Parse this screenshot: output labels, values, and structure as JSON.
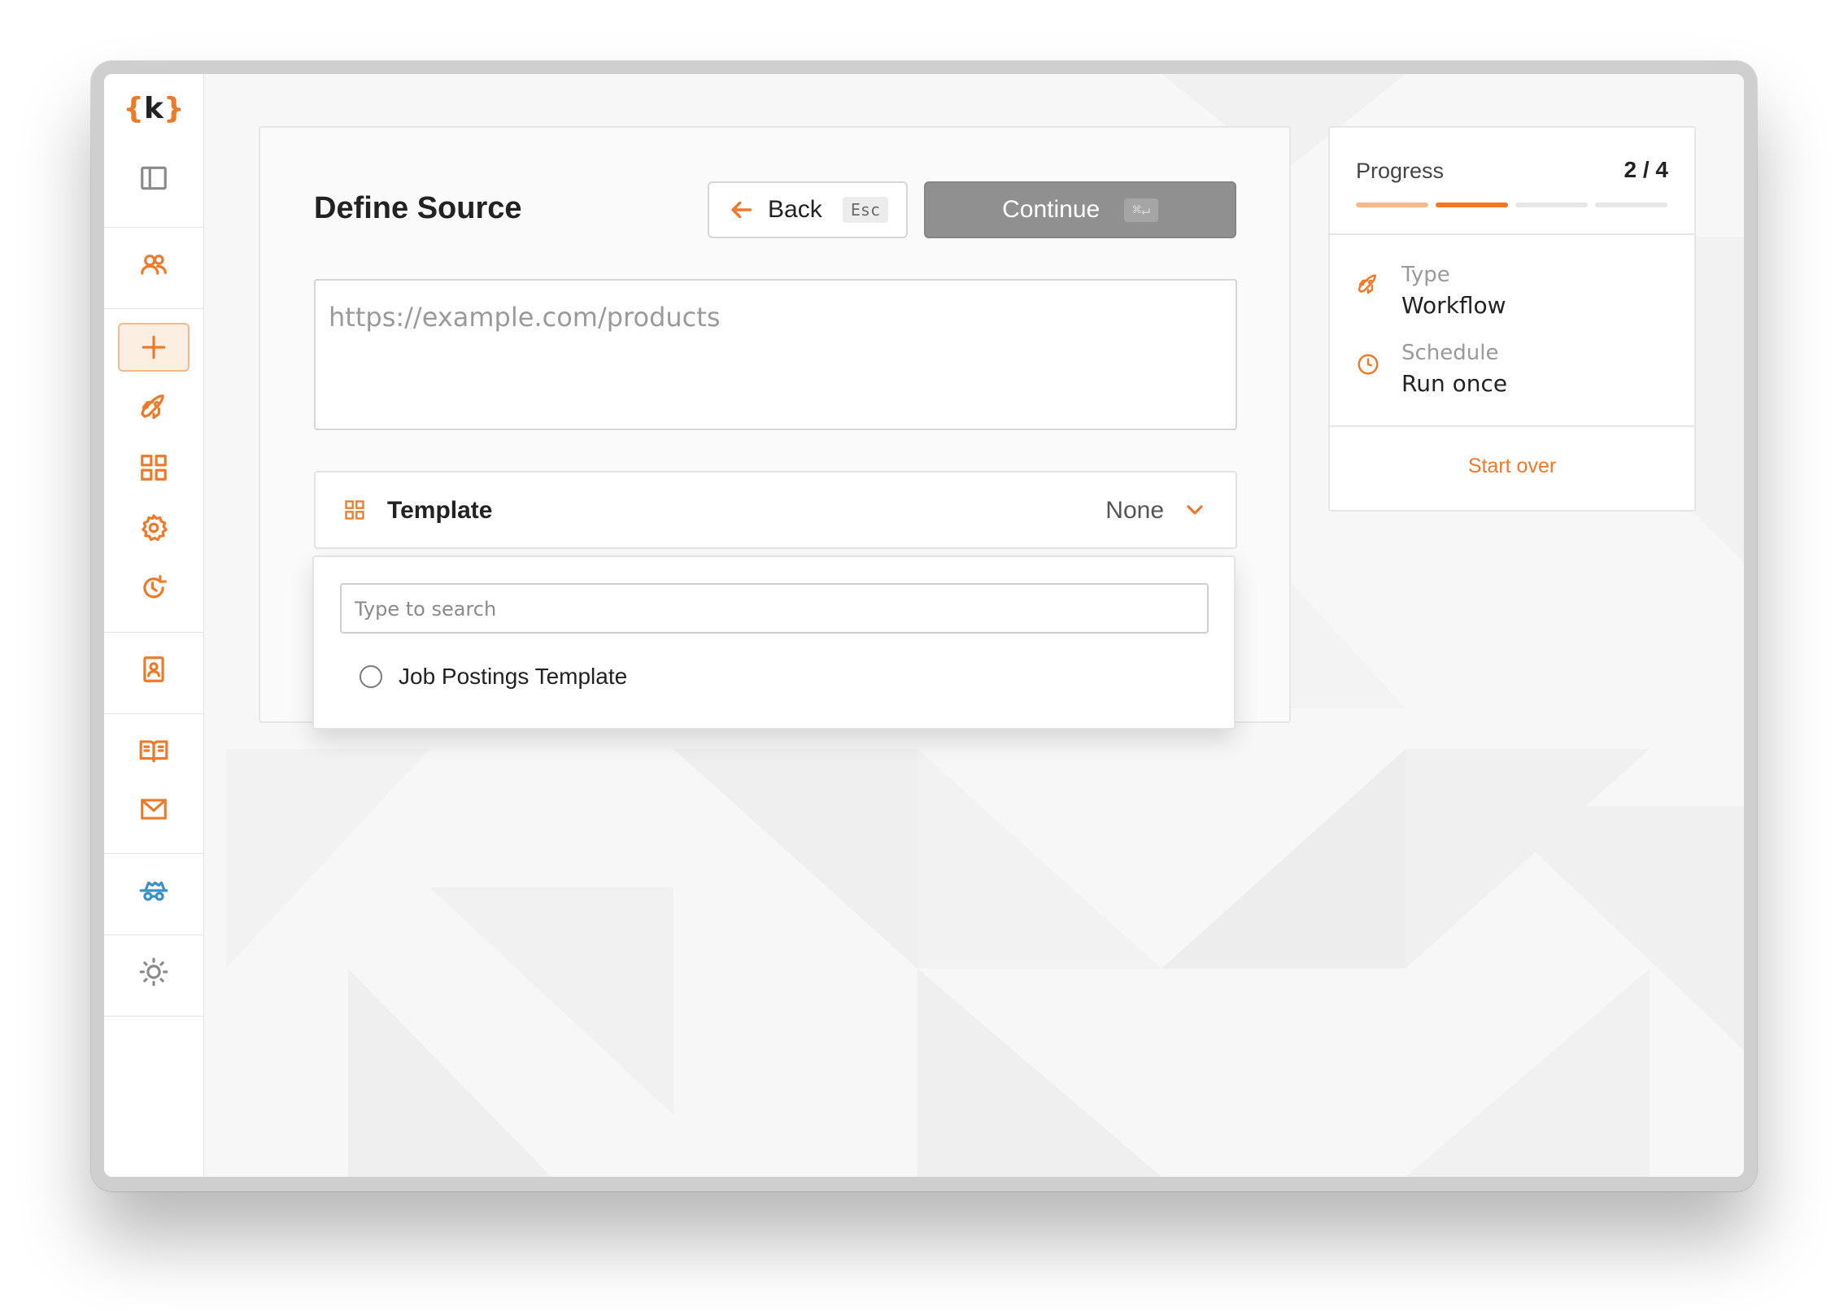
{
  "sidebar": {
    "logo": {
      "open": "{",
      "letter": "k",
      "close": "}"
    },
    "icons": [
      "panel-toggle-icon",
      "users-icon",
      "plus-icon",
      "rocket-icon",
      "grid-icon",
      "gear-icon",
      "refresh-clock-icon",
      "contact-card-icon",
      "book-icon",
      "mail-icon",
      "spy-icon",
      "sun-icon"
    ]
  },
  "main": {
    "title": "Define Source",
    "back": {
      "label": "Back",
      "shortcut": "Esc"
    },
    "continue": {
      "label": "Continue",
      "shortcut": "⌘↵"
    },
    "url_placeholder": "https://example.com/products",
    "template": {
      "label": "Template",
      "value": "None"
    },
    "dropdown": {
      "search_placeholder": "Type to search",
      "options": [
        {
          "label": "Job Postings Template"
        }
      ]
    }
  },
  "progress": {
    "title": "Progress",
    "count": "2 / 4",
    "current_step": 2,
    "total_steps": 4,
    "items": [
      {
        "label": "Type",
        "value": "Workflow",
        "icon": "rocket-icon"
      },
      {
        "label": "Schedule",
        "value": "Run once",
        "icon": "clock-icon"
      }
    ],
    "start_over": "Start over"
  },
  "colors": {
    "accent": "#ec7a2a",
    "accent_light": "#f8b98a",
    "button_disabled": "#909090"
  }
}
